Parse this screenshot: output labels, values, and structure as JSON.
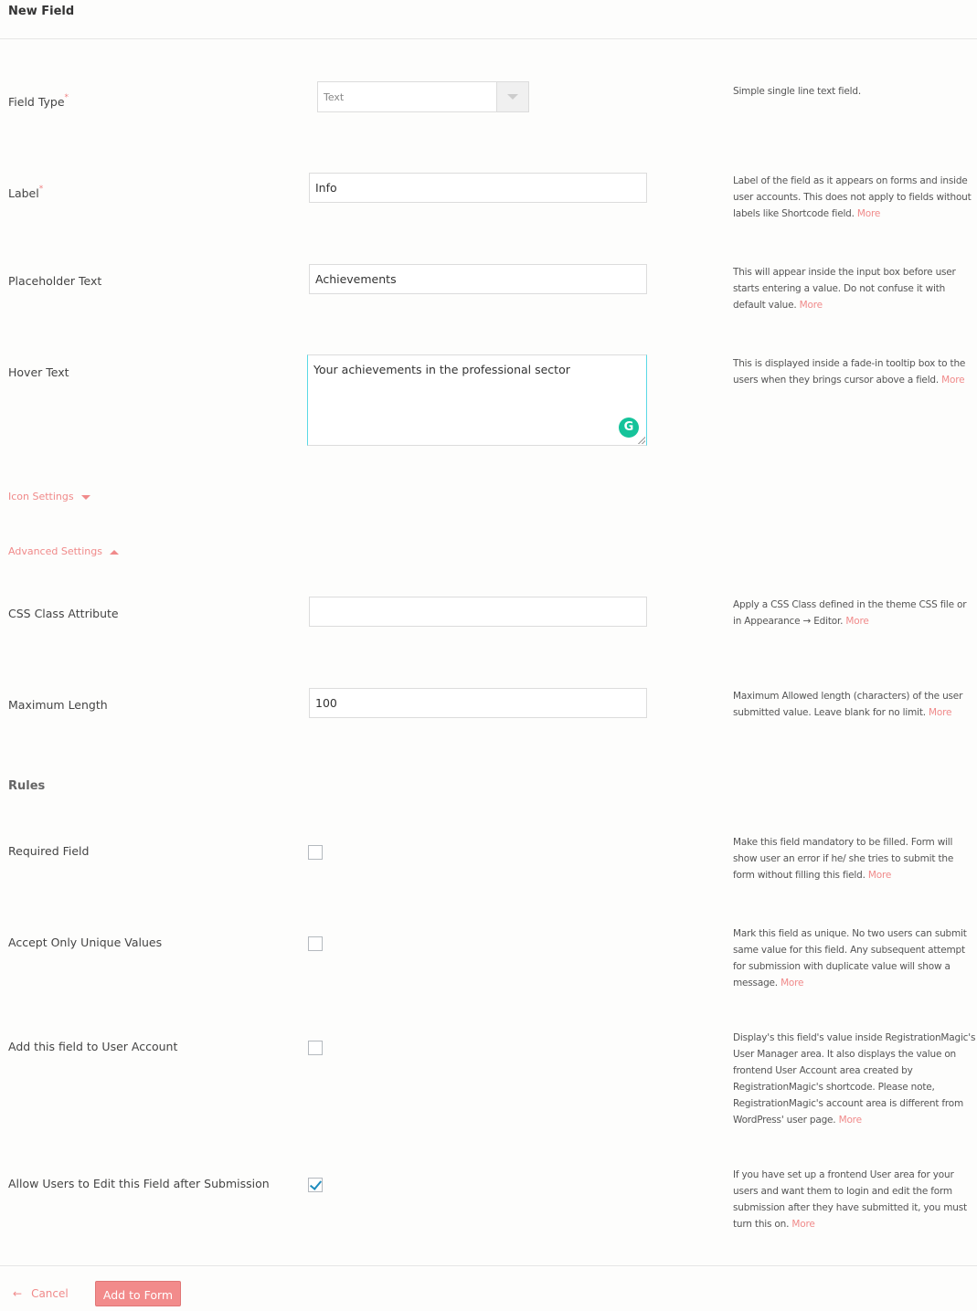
{
  "header": {
    "title": "New Field"
  },
  "fields": {
    "field_type": {
      "label": "Field Type",
      "required_mark": "*",
      "value": "Text",
      "help": "Simple single line text field."
    },
    "label": {
      "label": "Label",
      "required_mark": "*",
      "value": "Info",
      "help": "Label of the field as it appears on forms and inside user accounts. This does not apply to fields without labels like Shortcode field.",
      "more": "More"
    },
    "placeholder": {
      "label": "Placeholder Text",
      "value": "Achievements",
      "help": "This will appear inside the input box before user starts entering a value. Do not confuse it with default value.",
      "more": "More"
    },
    "hover_text": {
      "label": "Hover Text",
      "value": "Your achievements in the professional sector",
      "help": "This is displayed inside a fade-in tooltip box to the users when they brings cursor above a field.",
      "more": "More",
      "grammarly_icon": "G"
    },
    "css_class": {
      "label": "CSS Class Attribute",
      "value": "",
      "help": "Apply a CSS Class defined in the theme CSS file or in Appearance → Editor.",
      "more": "More"
    },
    "max_length": {
      "label": "Maximum Length",
      "value": "100",
      "help": "Maximum Allowed length (characters) of the user submitted value. Leave blank for no limit.",
      "more": "More"
    }
  },
  "toggles": {
    "icon_settings": {
      "label": "Icon Settings",
      "state": "collapsed"
    },
    "advanced_settings": {
      "label": "Advanced Settings",
      "state": "expanded"
    }
  },
  "rules": {
    "title": "Rules",
    "items": [
      {
        "label": "Required Field",
        "checked": false,
        "help": "Make this field mandatory to be filled. Form will show user an error if he/ she tries to submit the form without filling this field.",
        "more": "More"
      },
      {
        "label": "Accept Only Unique Values",
        "checked": false,
        "help": "Mark this field as unique. No two users can submit same value for this field. Any subsequent attempt for submission with duplicate value will show a message.",
        "more": "More"
      },
      {
        "label": "Add this field to User Account",
        "checked": false,
        "help": "Display's this field's value inside RegistrationMagic's User Manager area. It also displays the value on frontend User Account area created by RegistrationMagic's shortcode. Please note, RegistrationMagic's account area is different from WordPress' user page.",
        "more": "More"
      },
      {
        "label": "Allow Users to Edit this Field after Submission",
        "checked": true,
        "help": "If you have set up a frontend User area for your users and want them to login and edit the form submission after they have submitted it, you must turn this on.",
        "more": "More"
      }
    ]
  },
  "footer": {
    "cancel_arrow": "←",
    "cancel_label": "Cancel",
    "submit_label": "Add to Form"
  },
  "colors": {
    "accent": "#f08a8a",
    "button_bg": "#f28b8b",
    "focus_border": "#5ad9e6",
    "check": "#1e8cbe"
  }
}
